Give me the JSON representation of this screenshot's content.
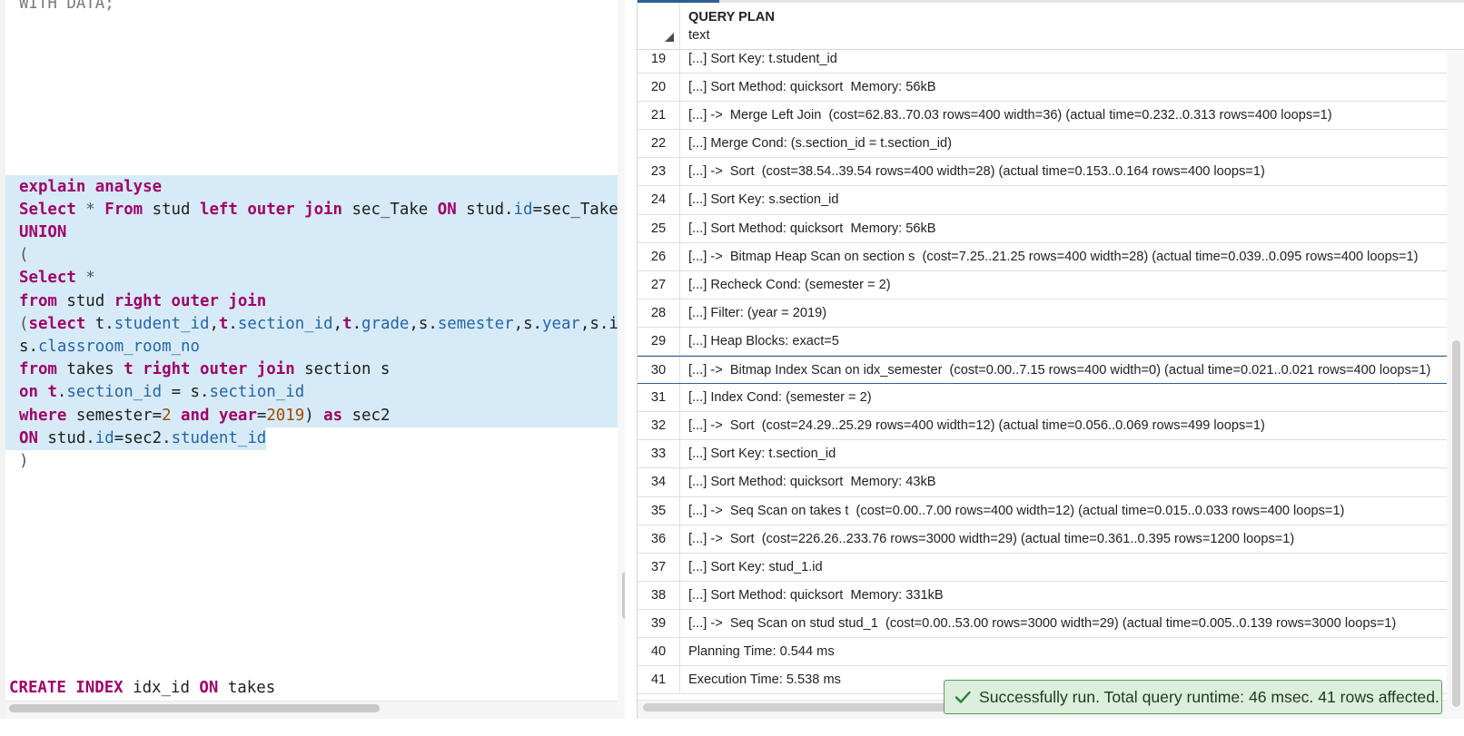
{
  "editor": {
    "lines": [
      [
        {
          "t": "WITH DATA;",
          "c": "ital"
        }
      ],
      [],
      [],
      [],
      [],
      [],
      [],
      [],
      [
        {
          "t": "explain analyse",
          "c": "kw"
        }
      ],
      [
        {
          "t": "Select",
          "c": "kw"
        },
        {
          "t": " * ",
          "c": "op"
        },
        {
          "t": "From",
          "c": "kw"
        },
        {
          "t": " stud "
        },
        {
          "t": "left outer join",
          "c": "kw"
        },
        {
          "t": " sec_Take "
        },
        {
          "t": "ON",
          "c": "kw"
        },
        {
          "t": " stud."
        },
        {
          "t": "id",
          "c": "fld"
        },
        {
          "t": "=sec_Take"
        }
      ],
      [
        {
          "t": "UNION",
          "c": "kw"
        }
      ],
      [
        {
          "t": "(",
          "c": "op"
        }
      ],
      [
        {
          "t": "Select",
          "c": "kw"
        },
        {
          "t": " *",
          "c": "op"
        }
      ],
      [
        {
          "t": "from",
          "c": "kw"
        },
        {
          "t": " stud "
        },
        {
          "t": "right outer join",
          "c": "kw"
        }
      ],
      [
        {
          "t": "(",
          "c": "op"
        },
        {
          "t": "select",
          "c": "kw"
        },
        {
          "t": " t."
        },
        {
          "t": "student_id",
          "c": "fld"
        },
        {
          "t": ","
        },
        {
          "t": "t",
          "c": "kw"
        },
        {
          "t": "."
        },
        {
          "t": "section_id",
          "c": "fld"
        },
        {
          "t": ","
        },
        {
          "t": "t",
          "c": "kw"
        },
        {
          "t": "."
        },
        {
          "t": "grade",
          "c": "fld"
        },
        {
          "t": ",s."
        },
        {
          "t": "semester",
          "c": "fld"
        },
        {
          "t": ",s."
        },
        {
          "t": "year",
          "c": "fld"
        },
        {
          "t": ",s.i"
        }
      ],
      [
        {
          "t": "s."
        },
        {
          "t": "classroom_room_no",
          "c": "fld"
        }
      ],
      [
        {
          "t": "from",
          "c": "kw"
        },
        {
          "t": " takes "
        },
        {
          "t": "t",
          "c": "kw"
        },
        {
          "t": " "
        },
        {
          "t": "right outer join",
          "c": "kw"
        },
        {
          "t": " section s"
        }
      ],
      [
        {
          "t": "on",
          "c": "kw"
        },
        {
          "t": " "
        },
        {
          "t": "t",
          "c": "kw"
        },
        {
          "t": "."
        },
        {
          "t": "section_id",
          "c": "fld"
        },
        {
          "t": " = s."
        },
        {
          "t": "section_id",
          "c": "fld"
        }
      ],
      [
        {
          "t": "where",
          "c": "kw"
        },
        {
          "t": " semester="
        },
        {
          "t": "2",
          "c": "num"
        },
        {
          "t": " "
        },
        {
          "t": "and",
          "c": "kw"
        },
        {
          "t": " "
        },
        {
          "t": "year",
          "c": "kw"
        },
        {
          "t": "="
        },
        {
          "t": "2019",
          "c": "num"
        },
        {
          "t": ") "
        },
        {
          "t": "as",
          "c": "kw"
        },
        {
          "t": " sec2"
        }
      ],
      [
        {
          "t": "ON",
          "c": "kw"
        },
        {
          "t": " stud."
        },
        {
          "t": "id",
          "c": "fld"
        },
        {
          "t": "=sec2."
        },
        {
          "t": "student_id",
          "c": "fld"
        }
      ],
      [
        {
          "t": ")",
          "c": "op"
        }
      ]
    ],
    "last_line": [
      {
        "t": "CREATE INDEX",
        "c": "kw"
      },
      {
        "t": " idx_id "
      },
      {
        "t": "ON",
        "c": "kw"
      },
      {
        "t": " takes"
      }
    ]
  },
  "grid": {
    "column_title": "QUERY PLAN",
    "column_type": "text",
    "selected_row": 30,
    "rows": [
      {
        "n": "19",
        "v": "[...] Sort Key: t.student_id"
      },
      {
        "n": "20",
        "v": "[...] Sort Method: quicksort  Memory: 56kB"
      },
      {
        "n": "21",
        "v": "[...] ->  Merge Left Join  (cost=62.83..70.03 rows=400 width=36) (actual time=0.232..0.313 rows=400 loops=1)"
      },
      {
        "n": "22",
        "v": "[...] Merge Cond: (s.section_id = t.section_id)"
      },
      {
        "n": "23",
        "v": "[...] ->  Sort  (cost=38.54..39.54 rows=400 width=28) (actual time=0.153..0.164 rows=400 loops=1)"
      },
      {
        "n": "24",
        "v": "[...] Sort Key: s.section_id"
      },
      {
        "n": "25",
        "v": "[...] Sort Method: quicksort  Memory: 56kB"
      },
      {
        "n": "26",
        "v": "[...] ->  Bitmap Heap Scan on section s  (cost=7.25..21.25 rows=400 width=28) (actual time=0.039..0.095 rows=400 loops=1)"
      },
      {
        "n": "27",
        "v": "[...] Recheck Cond: (semester = 2)"
      },
      {
        "n": "28",
        "v": "[...] Filter: (year = 2019)"
      },
      {
        "n": "29",
        "v": "[...] Heap Blocks: exact=5"
      },
      {
        "n": "30",
        "v": "[...] ->  Bitmap Index Scan on idx_semester  (cost=0.00..7.15 rows=400 width=0) (actual time=0.021..0.021 rows=400 loops=1)"
      },
      {
        "n": "31",
        "v": "[...] Index Cond: (semester = 2)"
      },
      {
        "n": "32",
        "v": "[...] ->  Sort  (cost=24.29..25.29 rows=400 width=12) (actual time=0.056..0.069 rows=499 loops=1)"
      },
      {
        "n": "33",
        "v": "[...] Sort Key: t.section_id"
      },
      {
        "n": "34",
        "v": "[...] Sort Method: quicksort  Memory: 43kB"
      },
      {
        "n": "35",
        "v": "[...] ->  Seq Scan on takes t  (cost=0.00..7.00 rows=400 width=12) (actual time=0.015..0.033 rows=400 loops=1)"
      },
      {
        "n": "36",
        "v": "[...] ->  Sort  (cost=226.26..233.76 rows=3000 width=29) (actual time=0.361..0.395 rows=1200 loops=1)"
      },
      {
        "n": "37",
        "v": "[...] Sort Key: stud_1.id"
      },
      {
        "n": "38",
        "v": "[...] Sort Method: quicksort  Memory: 331kB"
      },
      {
        "n": "39",
        "v": "[...] ->  Seq Scan on stud stud_1  (cost=0.00..53.00 rows=3000 width=29) (actual time=0.005..0.139 rows=3000 loops=1)"
      },
      {
        "n": "40",
        "v": "Planning Time: 0.544 ms"
      },
      {
        "n": "41",
        "v": "Execution Time: 5.538 ms"
      }
    ]
  },
  "toast": {
    "message": "Successfully run. Total query runtime: 46 msec. 41 rows affected.",
    "icon": "check-icon",
    "color": "#dcefdc"
  }
}
